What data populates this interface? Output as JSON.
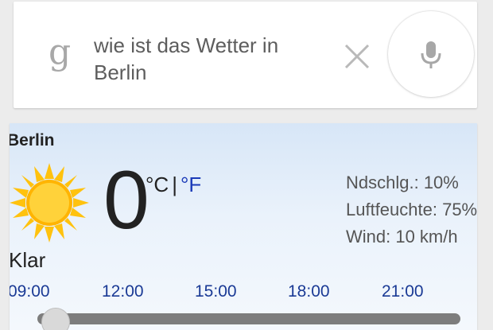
{
  "search": {
    "query_line1": "wie ist das Wetter in",
    "query_line2": "Berlin",
    "logo": "g",
    "clear_icon": "close-icon",
    "mic_icon": "mic-icon"
  },
  "weather": {
    "city": "Berlin",
    "temperature": "0",
    "unit_celsius": "°C",
    "unit_separator": "|",
    "unit_fahrenheit": "°F",
    "condition": "Klar",
    "condition_icon": "sun-icon",
    "details": {
      "precipitation": "Ndschlg.: 10%",
      "humidity": "Luftfeuchte: 75%",
      "wind": "Wind: 10 km/h"
    },
    "hourly_times": [
      "09:00",
      "12:00",
      "15:00",
      "18:00",
      "21:00"
    ]
  },
  "colors": {
    "link_blue": "#1a3ab8",
    "sun_yellow": "#ffc20e",
    "slider_track": "#7d7d7d"
  }
}
